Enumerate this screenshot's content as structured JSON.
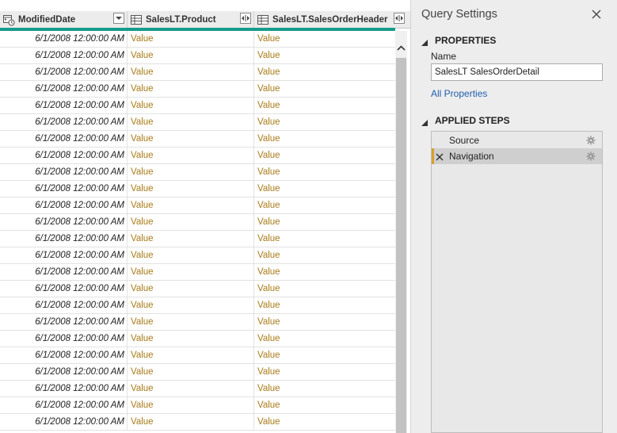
{
  "grid": {
    "columns": [
      {
        "label": "ModifiedDate",
        "type_icon": "datetime-type-icon",
        "button": "dropdown"
      },
      {
        "label": "SalesLT.Product",
        "type_icon": "table-type-icon",
        "button": "expand"
      },
      {
        "label": "SalesLT.SalesOrderHeader",
        "type_icon": "table-type-icon",
        "button": "expand"
      }
    ],
    "rows": [
      [
        "6/1/2008 12:00:00 AM",
        "Value",
        "Value"
      ],
      [
        "6/1/2008 12:00:00 AM",
        "Value",
        "Value"
      ],
      [
        "6/1/2008 12:00:00 AM",
        "Value",
        "Value"
      ],
      [
        "6/1/2008 12:00:00 AM",
        "Value",
        "Value"
      ],
      [
        "6/1/2008 12:00:00 AM",
        "Value",
        "Value"
      ],
      [
        "6/1/2008 12:00:00 AM",
        "Value",
        "Value"
      ],
      [
        "6/1/2008 12:00:00 AM",
        "Value",
        "Value"
      ],
      [
        "6/1/2008 12:00:00 AM",
        "Value",
        "Value"
      ],
      [
        "6/1/2008 12:00:00 AM",
        "Value",
        "Value"
      ],
      [
        "6/1/2008 12:00:00 AM",
        "Value",
        "Value"
      ],
      [
        "6/1/2008 12:00:00 AM",
        "Value",
        "Value"
      ],
      [
        "6/1/2008 12:00:00 AM",
        "Value",
        "Value"
      ],
      [
        "6/1/2008 12:00:00 AM",
        "Value",
        "Value"
      ],
      [
        "6/1/2008 12:00:00 AM",
        "Value",
        "Value"
      ],
      [
        "6/1/2008 12:00:00 AM",
        "Value",
        "Value"
      ],
      [
        "6/1/2008 12:00:00 AM",
        "Value",
        "Value"
      ],
      [
        "6/1/2008 12:00:00 AM",
        "Value",
        "Value"
      ],
      [
        "6/1/2008 12:00:00 AM",
        "Value",
        "Value"
      ],
      [
        "6/1/2008 12:00:00 AM",
        "Value",
        "Value"
      ],
      [
        "6/1/2008 12:00:00 AM",
        "Value",
        "Value"
      ],
      [
        "6/1/2008 12:00:00 AM",
        "Value",
        "Value"
      ],
      [
        "6/1/2008 12:00:00 AM",
        "Value",
        "Value"
      ],
      [
        "6/1/2008 12:00:00 AM",
        "Value",
        "Value"
      ],
      [
        "6/1/2008 12:00:00 AM",
        "Value",
        "Value"
      ]
    ]
  },
  "query_settings": {
    "title": "Query Settings",
    "properties": {
      "heading": "PROPERTIES",
      "name_label": "Name",
      "name_value": "SalesLT SalesOrderDetail",
      "all_properties_link": "All Properties"
    },
    "applied_steps": {
      "heading": "APPLIED STEPS",
      "steps": [
        {
          "label": "Source",
          "active": false
        },
        {
          "label": "Navigation",
          "active": true
        }
      ]
    }
  },
  "colors": {
    "accent_bar": "#169b8c",
    "value_text": "#a97c1a",
    "link": "#1f5fad",
    "active_step_marker": "#d6a02a"
  },
  "icons": [
    "datetime-type-icon",
    "table-type-icon",
    "dropdown-icon",
    "expand-icon",
    "scroll-up-icon",
    "close-icon",
    "collapse-triangle-icon",
    "delete-step-icon",
    "gear-icon"
  ]
}
